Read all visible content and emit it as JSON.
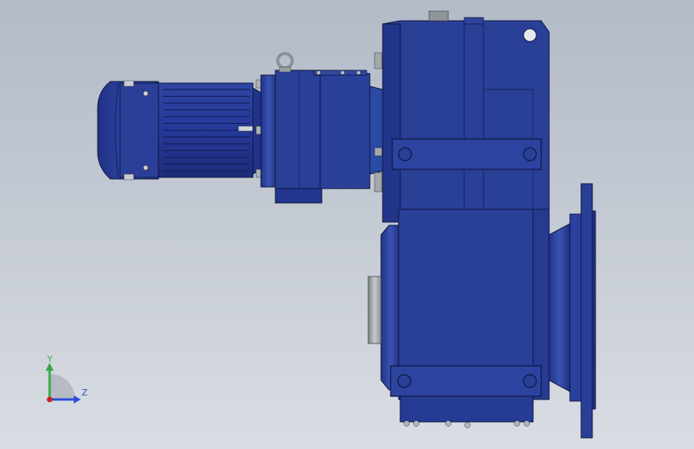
{
  "viewport": {
    "background_top": "#b3bbc8",
    "background_bottom": "#d9dde3"
  },
  "model": {
    "body_color": "#2a3f8f",
    "dark_color": "#1a2a6a",
    "highlight_color": "#3c56b4",
    "edge_color": "#0d1640",
    "metal_color": "#9aa0a6",
    "shaft_color": "#b6b9bc"
  },
  "triad": {
    "y_label": "Y",
    "z_label": "Z",
    "y_color": "#3aa84a",
    "z_color": "#2a4fd8",
    "x_color": "#c8201e"
  }
}
